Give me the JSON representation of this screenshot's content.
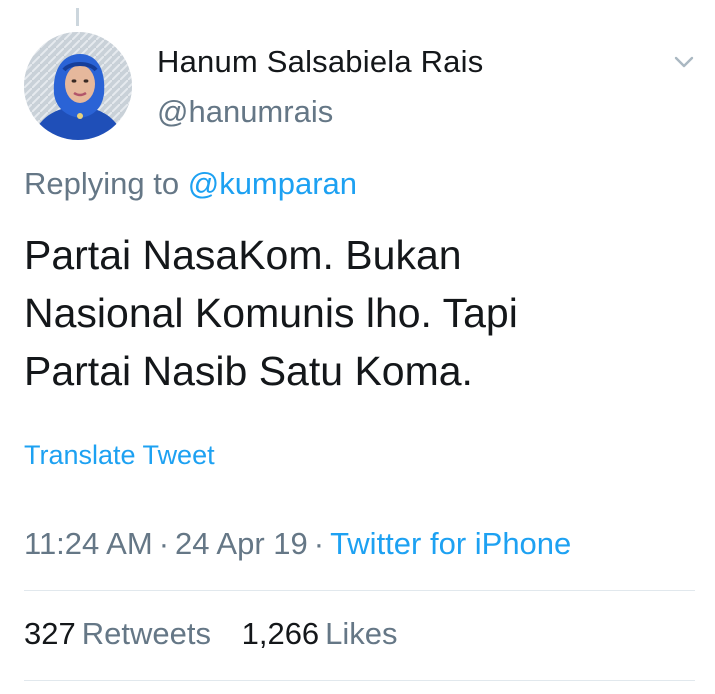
{
  "author": {
    "display_name": "Hanum Salsabiela Rais",
    "handle": "@hanumrais",
    "avatar_icon": "profile-photo"
  },
  "menu": {
    "icon": "chevron-down-icon"
  },
  "reply": {
    "prefix": "Replying to",
    "mention": "@kumparan"
  },
  "tweet": {
    "text": "Partai NasaKom. Bukan\nNasional Komunis lho. Tapi\nPartai Nasib Satu Koma.",
    "translate_label": "Translate Tweet"
  },
  "meta": {
    "time": "11:24 AM",
    "separator": "·",
    "date": "24 Apr 19",
    "source": "Twitter for iPhone"
  },
  "stats": {
    "retweets_count": "327",
    "retweets_label": "Retweets",
    "likes_count": "1,266",
    "likes_label": "Likes"
  },
  "colors": {
    "link": "#1da1f2",
    "secondary_text": "#657786",
    "primary_text": "#14171a",
    "divider": "#e1e8ed"
  }
}
